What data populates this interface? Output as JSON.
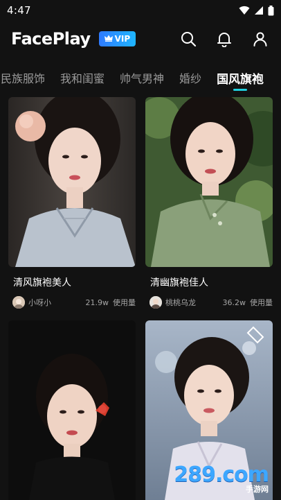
{
  "status_bar": {
    "time": "4:47",
    "icons": [
      "wifi-icon",
      "cellular-signal-icon",
      "battery-icon"
    ]
  },
  "header": {
    "app_name": "FacePlay",
    "vip_label": "VIP",
    "actions": [
      "search-icon",
      "bell-icon",
      "profile-icon"
    ]
  },
  "tabs": {
    "items": [
      "民族服饰",
      "我和闺蜜",
      "帅气男神",
      "婚纱",
      "国风旗袍"
    ],
    "active_index": 4,
    "accent": "#1fd1e0"
  },
  "cards": [
    {
      "title": "清风旗袍美人",
      "author": "小呀小",
      "usage_count": "21.9w",
      "usage_label": "使用量"
    },
    {
      "title": "清幽旗袍佳人",
      "author": "桃桃乌龙",
      "usage_count": "36.2w",
      "usage_label": "使用量"
    },
    {
      "title": "",
      "author": "",
      "usage_count": "",
      "usage_label": ""
    },
    {
      "title": "",
      "author": "",
      "usage_count": "",
      "usage_label": ""
    }
  ],
  "watermark": {
    "main": "289.com",
    "sub": "手游网"
  },
  "colors": {
    "background": "#121212",
    "vip_gradient_start": "#2f7bff",
    "vip_gradient_end": "#1fb6ff",
    "muted_text": "#9b9b9b"
  }
}
